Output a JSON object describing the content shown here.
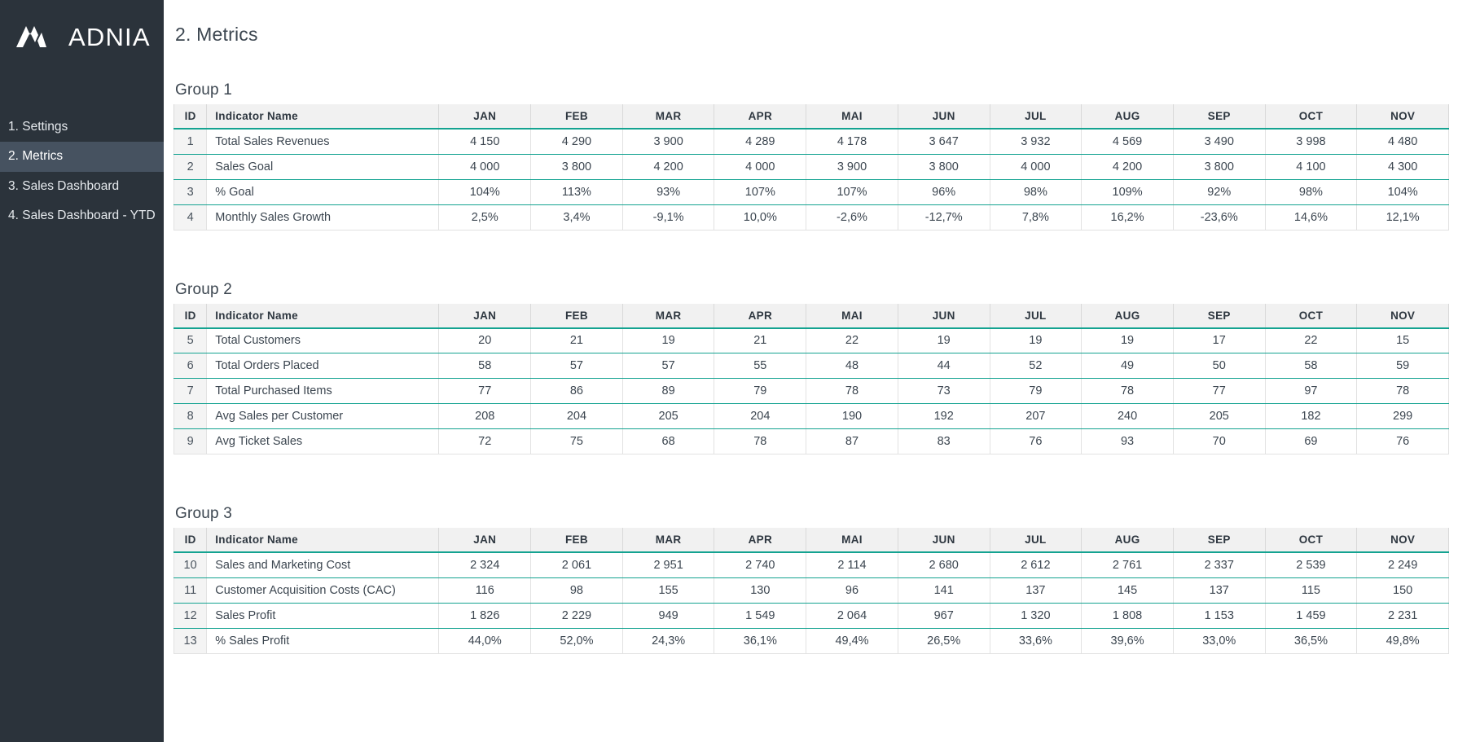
{
  "sidebar": {
    "logo_text": "ADNIA",
    "logo_icon": "adnia-logo-mark",
    "items": [
      {
        "label": "1. Settings",
        "active": false
      },
      {
        "label": "2. Metrics",
        "active": true
      },
      {
        "label": "3. Sales Dashboard",
        "active": false
      },
      {
        "label": "4. Sales Dashboard - YTD",
        "active": false
      }
    ]
  },
  "main": {
    "page_title": "2. Metrics"
  },
  "colors": {
    "sidebar_bg": "#2b333b",
    "sidebar_active": "#465260",
    "accent_teal": "#14a391",
    "header_bg": "#f1f1f1",
    "text": "#3c4650",
    "comment_marker": "#e8202a"
  },
  "chart_data": {
    "type": "table",
    "title": "2. Metrics",
    "columns": [
      "ID",
      "Indicator Name",
      "JAN",
      "FEB",
      "MAR",
      "APR",
      "MAI",
      "JUN",
      "JUL",
      "AUG",
      "SEP",
      "OCT",
      "NOV"
    ],
    "groups": [
      {
        "title": "Group 1",
        "columns": [
          "ID",
          "Indicator Name",
          "JAN",
          "FEB",
          "MAR",
          "APR",
          "MAI",
          "JUN",
          "JUL",
          "AUG",
          "SEP",
          "OCT",
          "NOV"
        ],
        "rows": [
          {
            "id": "1",
            "name": "Total Sales Revenues",
            "values": [
              "4 150",
              "4 290",
              "3 900",
              "4 289",
              "4 178",
              "3 647",
              "3 932",
              "4 569",
              "3 490",
              "3 998",
              "4 480"
            ]
          },
          {
            "id": "2",
            "name": "Sales Goal",
            "values": [
              "4 000",
              "3 800",
              "4 200",
              "4 000",
              "3 900",
              "3 800",
              "4 000",
              "4 200",
              "3 800",
              "4 100",
              "4 300"
            ]
          },
          {
            "id": "3",
            "name": "% Goal",
            "values": [
              "104%",
              "113%",
              "93%",
              "107%",
              "107%",
              "96%",
              "98%",
              "109%",
              "92%",
              "98%",
              "104%"
            ]
          },
          {
            "id": "4",
            "name": "Monthly Sales Growth",
            "values": [
              "2,5%",
              "3,4%",
              "-9,1%",
              "10,0%",
              "-2,6%",
              "-12,7%",
              "7,8%",
              "16,2%",
              "-23,6%",
              "14,6%",
              "12,1%"
            ],
            "comment_on_index": 0
          }
        ]
      },
      {
        "title": "Group 2",
        "columns": [
          "ID",
          "Indicator Name",
          "JAN",
          "FEB",
          "MAR",
          "APR",
          "MAI",
          "JUN",
          "JUL",
          "AUG",
          "SEP",
          "OCT",
          "NOV"
        ],
        "rows": [
          {
            "id": "5",
            "name": "Total Customers",
            "values": [
              "20",
              "21",
              "19",
              "21",
              "22",
              "19",
              "19",
              "19",
              "17",
              "22",
              "15"
            ]
          },
          {
            "id": "6",
            "name": "Total Orders Placed",
            "values": [
              "58",
              "57",
              "57",
              "55",
              "48",
              "44",
              "52",
              "49",
              "50",
              "58",
              "59"
            ]
          },
          {
            "id": "7",
            "name": "Total Purchased Items",
            "values": [
              "77",
              "86",
              "89",
              "79",
              "78",
              "73",
              "79",
              "78",
              "77",
              "97",
              "78"
            ]
          },
          {
            "id": "8",
            "name": "Avg Sales per Customer",
            "values": [
              "208",
              "204",
              "205",
              "204",
              "190",
              "192",
              "207",
              "240",
              "205",
              "182",
              "299"
            ]
          },
          {
            "id": "9",
            "name": "Avg Ticket Sales",
            "values": [
              "72",
              "75",
              "68",
              "78",
              "87",
              "83",
              "76",
              "93",
              "70",
              "69",
              "76"
            ]
          }
        ]
      },
      {
        "title": "Group 3",
        "columns": [
          "ID",
          "Indicator Name",
          "JAN",
          "FEB",
          "MAR",
          "APR",
          "MAI",
          "JUN",
          "JUL",
          "AUG",
          "SEP",
          "OCT",
          "NOV"
        ],
        "rows": [
          {
            "id": "10",
            "name": "Sales and Marketing Cost",
            "values": [
              "2 324",
              "2 061",
              "2 951",
              "2 740",
              "2 114",
              "2 680",
              "2 612",
              "2 761",
              "2 337",
              "2 539",
              "2 249"
            ]
          },
          {
            "id": "11",
            "name": "Customer Acquisition Costs (CAC)",
            "values": [
              "116",
              "98",
              "155",
              "130",
              "96",
              "141",
              "137",
              "145",
              "137",
              "115",
              "150"
            ]
          },
          {
            "id": "12",
            "name": "Sales Profit",
            "values": [
              "1 826",
              "2 229",
              "949",
              "1 549",
              "2 064",
              "967",
              "1 320",
              "1 808",
              "1 153",
              "1 459",
              "2 231"
            ]
          },
          {
            "id": "13",
            "name": "% Sales Profit",
            "values": [
              "44,0%",
              "52,0%",
              "24,3%",
              "36,1%",
              "49,4%",
              "26,5%",
              "33,6%",
              "39,6%",
              "33,0%",
              "36,5%",
              "49,8%"
            ]
          }
        ]
      }
    ]
  }
}
